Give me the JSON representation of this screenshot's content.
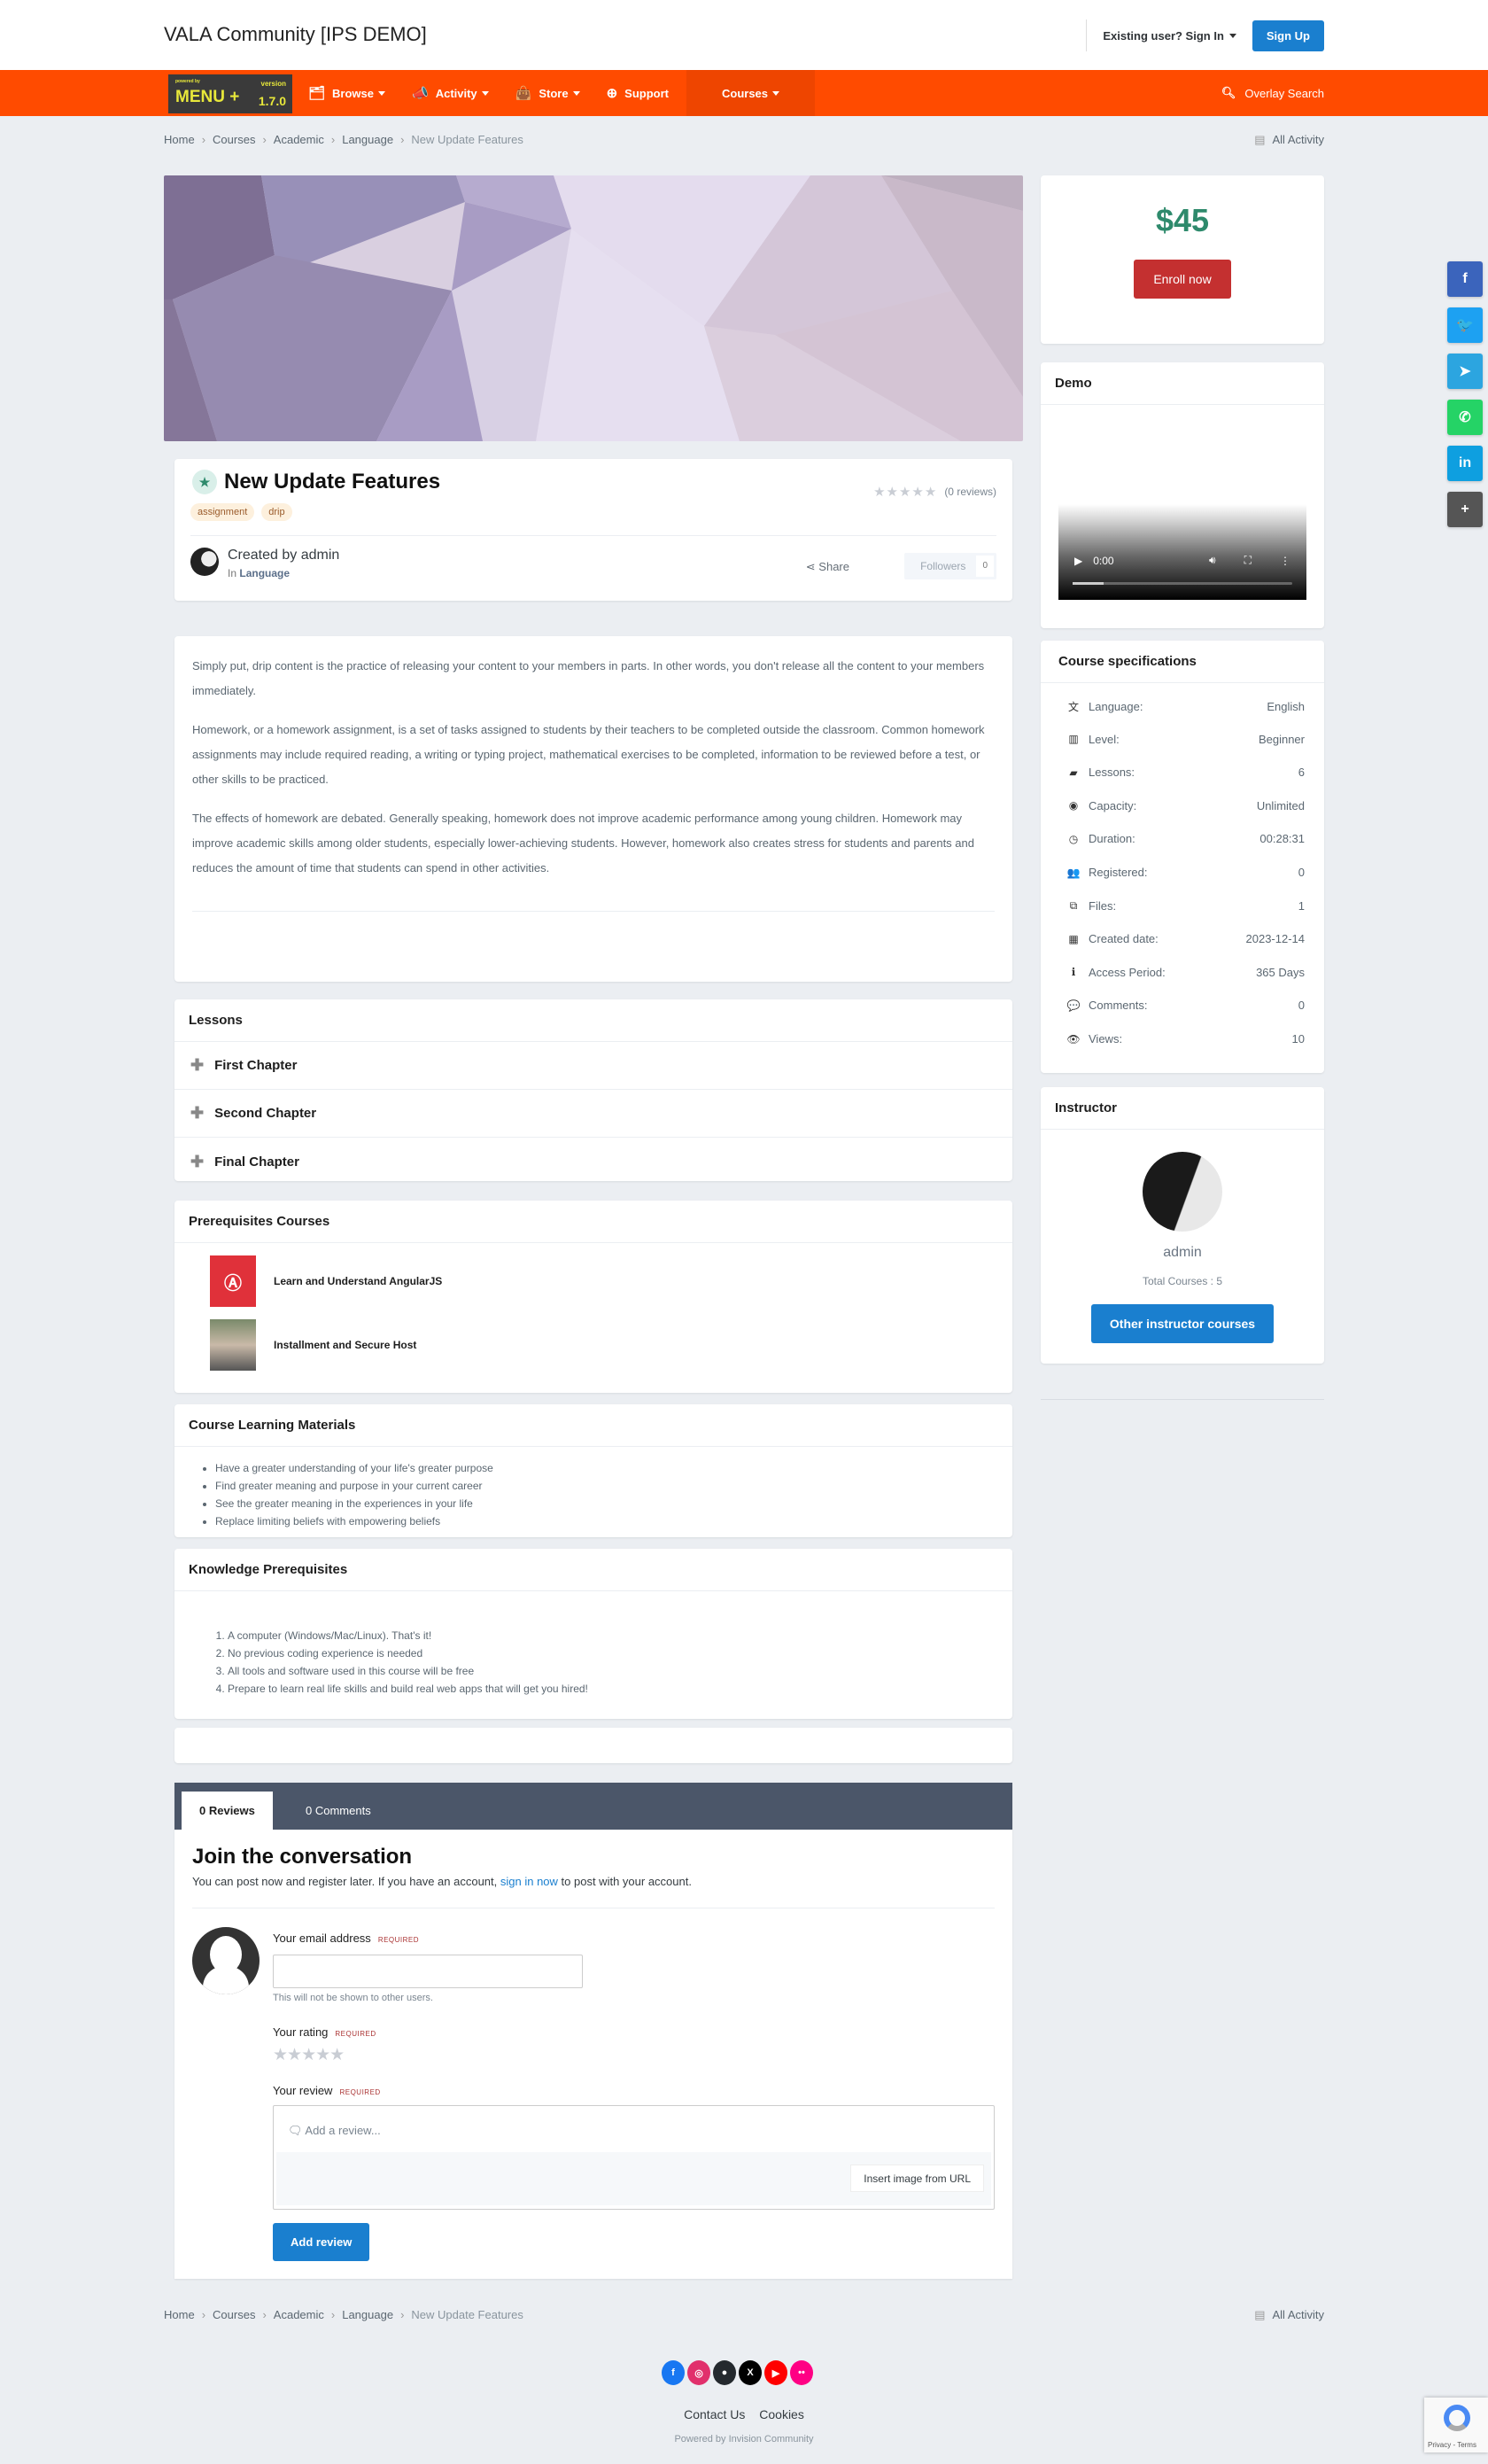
{
  "header": {
    "site_title": "VALA Community [IPS DEMO]",
    "sign_in": "Existing user? Sign In",
    "sign_up": "Sign Up"
  },
  "navbar": {
    "brand": {
      "powered_by": "powered by",
      "name": "MENU +",
      "version_label": "version",
      "version": "1.7.0"
    },
    "items": [
      {
        "label": "Browse",
        "icon": "folder-search-icon",
        "dropdown": true
      },
      {
        "label": "Activity",
        "icon": "megaphone-icon",
        "dropdown": true
      },
      {
        "label": "Store",
        "icon": "shopping-bag-icon",
        "dropdown": true
      },
      {
        "label": "Support",
        "icon": "lifebuoy-icon",
        "dropdown": false
      },
      {
        "label": "Courses",
        "icon": "",
        "dropdown": true,
        "active": true
      }
    ],
    "search_label": "Overlay Search",
    "accent": "#ff4b00"
  },
  "breadcrumb": {
    "items": [
      "Home",
      "Courses",
      "Academic",
      "Language",
      "New Update Features"
    ],
    "all_activity": "All Activity"
  },
  "course": {
    "title": "New Update Features",
    "tags": [
      "assignment",
      "drip"
    ],
    "stars": "★★★★★",
    "rating_value": 0,
    "reviews_count": "(0 reviews)",
    "created_by": "Created by admin",
    "in_label": "In",
    "category": "Language",
    "share_label": "Share",
    "followers_label": "Followers",
    "followers_count": "0"
  },
  "description": [
    "Simply put, drip content is the practice of releasing your content to your members in parts. In other words, you don't release all the content to your members immediately.",
    "Homework, or a homework assignment, is a set of tasks assigned to students by their teachers to be completed outside the classroom. Common homework assignments may include required reading, a writing or typing project, mathematical exercises to be completed, information to be reviewed before a test, or other skills to be practiced.",
    "The effects of homework are debated. Generally speaking, homework does not improve academic performance among young children. Homework may improve academic skills among older students, especially lower-achieving students. However, homework also creates stress for students and parents and reduces the amount of time that students can spend in other activities."
  ],
  "lessons": {
    "title": "Lessons",
    "items": [
      "First Chapter",
      "Second Chapter",
      "Final Chapter"
    ]
  },
  "prerequisite_courses": {
    "title": "Prerequisites Courses",
    "items": [
      "Learn and Understand AngularJS",
      "Installment and Secure Host"
    ]
  },
  "learning_materials": {
    "title": "Course Learning Materials",
    "items": [
      "Have a greater understanding of your life's greater purpose",
      "Find greater meaning and purpose in your current career",
      "See the greater meaning in the experiences in your life",
      "Replace limiting beliefs with empowering beliefs"
    ]
  },
  "knowledge_prerequisites": {
    "title": "Knowledge Prerequisites",
    "items": [
      "A computer (Windows/Mac/Linux). That's it!",
      "No previous coding experience is needed",
      "All tools and software used in this course will be free",
      "Prepare to learn real life skills and build real web apps that will get you hired!"
    ]
  },
  "reviews": {
    "tabs": [
      "0 Reviews",
      "0 Comments"
    ],
    "join_title": "Join the conversation",
    "join_sub_before": "You can post now and register later. If you have an account,",
    "join_sub_link": "sign in now",
    "join_sub_after": "to post with your account.",
    "email_label": "Your email address",
    "required": "REQUIRED",
    "email_value": "",
    "email_hint": "This will not be shown to other users.",
    "rating_label": "Your rating",
    "rating_stars": "★★★★★",
    "review_label": "Your review",
    "review_placeholder": "Add a review...",
    "insert_image": "Insert image from URL",
    "submit": "Add review"
  },
  "sidebar": {
    "price": "$45",
    "enroll": "Enroll now",
    "demo_title": "Demo",
    "video": {
      "time": "0:00",
      "progress": 0.14
    },
    "specs_title": "Course specifications",
    "specs": [
      {
        "icon": "language-icon",
        "glyph": "文",
        "label": "Language:",
        "value": "English"
      },
      {
        "icon": "bar-chart-icon",
        "glyph": "▥",
        "label": "Level:",
        "value": "Beginner"
      },
      {
        "icon": "book-icon",
        "glyph": "▰",
        "label": "Lessons:",
        "value": "6"
      },
      {
        "icon": "user-circle-icon",
        "glyph": "◉",
        "label": "Capacity:",
        "value": "Unlimited"
      },
      {
        "icon": "clock-icon",
        "glyph": "◷",
        "label": "Duration:",
        "value": "00:28:31"
      },
      {
        "icon": "users-icon",
        "glyph": "👥",
        "label": "Registered:",
        "value": "0"
      },
      {
        "icon": "files-icon",
        "glyph": "⧉",
        "label": "Files:",
        "value": "1"
      },
      {
        "icon": "calendar-check-icon",
        "glyph": "▦",
        "label": "Created date:",
        "value": "2023-12-14"
      },
      {
        "icon": "info-icon",
        "glyph": "ℹ",
        "label": "Access Period:",
        "value": "365 Days"
      },
      {
        "icon": "comment-icon",
        "glyph": "💬",
        "label": "Comments:",
        "value": "0"
      },
      {
        "icon": "eye-icon",
        "glyph": "👁",
        "label": "Views:",
        "value": "10"
      }
    ],
    "instructor_title": "Instructor",
    "instructor_name": "admin",
    "instructor_total": "Total Courses : 5",
    "instructor_button": "Other instructor courses"
  },
  "share_buttons": [
    {
      "name": "facebook",
      "glyph": "f",
      "color": "#3b64bc"
    },
    {
      "name": "twitter",
      "glyph": "🐦",
      "color": "#1da1f2"
    },
    {
      "name": "telegram",
      "glyph": "➤",
      "color": "#2ca5e0"
    },
    {
      "name": "whatsapp",
      "glyph": "✆",
      "color": "#25d366"
    },
    {
      "name": "linkedin",
      "glyph": "in",
      "color": "#0e9fe0"
    },
    {
      "name": "more",
      "glyph": "+",
      "color": "#555555"
    }
  ],
  "footer": {
    "social": [
      {
        "name": "facebook",
        "glyph": "f",
        "color": "#1877f2"
      },
      {
        "name": "instagram",
        "glyph": "◎",
        "color": "#e1306c"
      },
      {
        "name": "github",
        "glyph": "●",
        "color": "#24292e"
      },
      {
        "name": "x",
        "glyph": "X",
        "color": "#000000"
      },
      {
        "name": "youtube",
        "glyph": "▶",
        "color": "#ff0000"
      },
      {
        "name": "flickr",
        "glyph": "••",
        "color": "#ff0084"
      }
    ],
    "links": [
      "Contact Us",
      "Cookies"
    ],
    "powered_by": "Powered by Invision Community",
    "recaptcha": "Privacy - Terms"
  }
}
